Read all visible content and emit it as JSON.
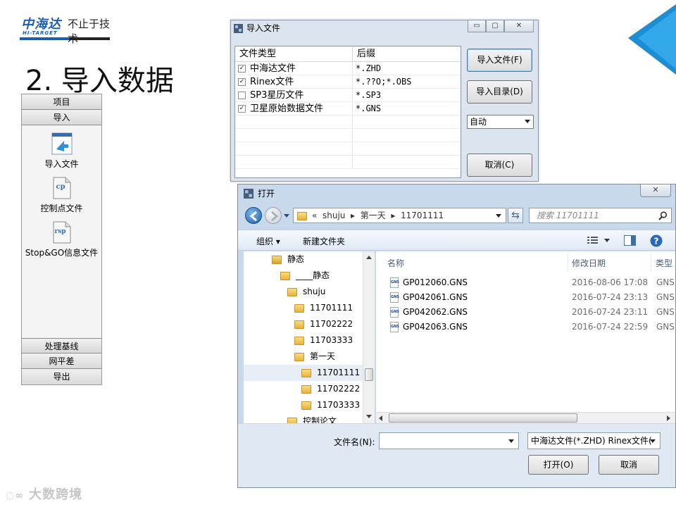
{
  "logo": {
    "brand_cn": "中海达",
    "brand_en": "HI-TARGET",
    "slogan": "不止于技术"
  },
  "slide": {
    "title": "2. 导入数据"
  },
  "nav_panel": {
    "header_top": "项目",
    "header_import": "导入",
    "items": [
      {
        "label": "导入文件",
        "icon": "import-file-icon"
      },
      {
        "label": "控制点文件",
        "icon": "cp-file-icon",
        "icon_text": "cp"
      },
      {
        "label": "Stop&GO信息文件",
        "icon": "rsp-file-icon",
        "icon_text": "rsp"
      }
    ],
    "bottom_items": [
      "处理基线",
      "网平差",
      "导出"
    ]
  },
  "import_dialog": {
    "title": "导入文件",
    "columns": [
      "文件类型",
      "后缀"
    ],
    "rows": [
      {
        "type": "中海达文件",
        "suffix": "*.ZHD",
        "checked": true,
        "mark": "✓"
      },
      {
        "type": "Rinex文件",
        "suffix": "*.??O;*.OBS",
        "checked": true,
        "mark": "✓"
      },
      {
        "type": "SP3星历文件",
        "suffix": "*.SP3",
        "checked": false,
        "mark": ""
      },
      {
        "type": "卫星原始数据文件",
        "suffix": "*.GNS",
        "checked": true,
        "mark": "✓"
      }
    ],
    "btn_import_file": "导入文件(F)",
    "btn_import_dir": "导入目录(D)",
    "mode_select": "自动",
    "btn_cancel": "取消(C)",
    "win_min": "▭",
    "win_max": "▢",
    "win_close": "✕"
  },
  "open_dialog": {
    "title": "打开",
    "close": "✕",
    "breadcrumb": [
      "«",
      "shuju",
      "▸",
      "第一天",
      "▸",
      "11701111"
    ],
    "search_placeholder": "搜索 11701111",
    "toolbar": {
      "organize": "组织 ▾",
      "new_folder": "新建文件夹"
    },
    "tree": [
      {
        "label": "静态",
        "indent": 40,
        "locked": true
      },
      {
        "label": "____静态",
        "indent": 52
      },
      {
        "label": "shuju",
        "indent": 62
      },
      {
        "label": "11701111",
        "indent": 72
      },
      {
        "label": "11702222",
        "indent": 72
      },
      {
        "label": "11703333",
        "indent": 72
      },
      {
        "label": "第一天",
        "indent": 72
      },
      {
        "label": "11701111",
        "indent": 82,
        "selected": true
      },
      {
        "label": "11702222",
        "indent": 82
      },
      {
        "label": "11703333",
        "indent": 82
      },
      {
        "label": "控制论文",
        "indent": 62
      }
    ],
    "columns": {
      "name": "名称",
      "date": "修改日期",
      "type": "类型"
    },
    "files": [
      {
        "name": "GP012060.GNS",
        "date": "2016-08-06 17:08",
        "type": "GNS"
      },
      {
        "name": "GP042061.GNS",
        "date": "2016-07-24 23:13",
        "type": "GNS"
      },
      {
        "name": "GP042062.GNS",
        "date": "2016-07-24 23:11",
        "type": "GNS"
      },
      {
        "name": "GP042063.GNS",
        "date": "2016-07-24 22:59",
        "type": "GNS"
      }
    ],
    "filename_label": "文件名(N):",
    "filename_value": "",
    "filter_value": "中海达文件(*.ZHD) Rinex文件(",
    "btn_open": "打开(O)",
    "btn_cancel": "取消"
  },
  "watermark": "大数跨境"
}
